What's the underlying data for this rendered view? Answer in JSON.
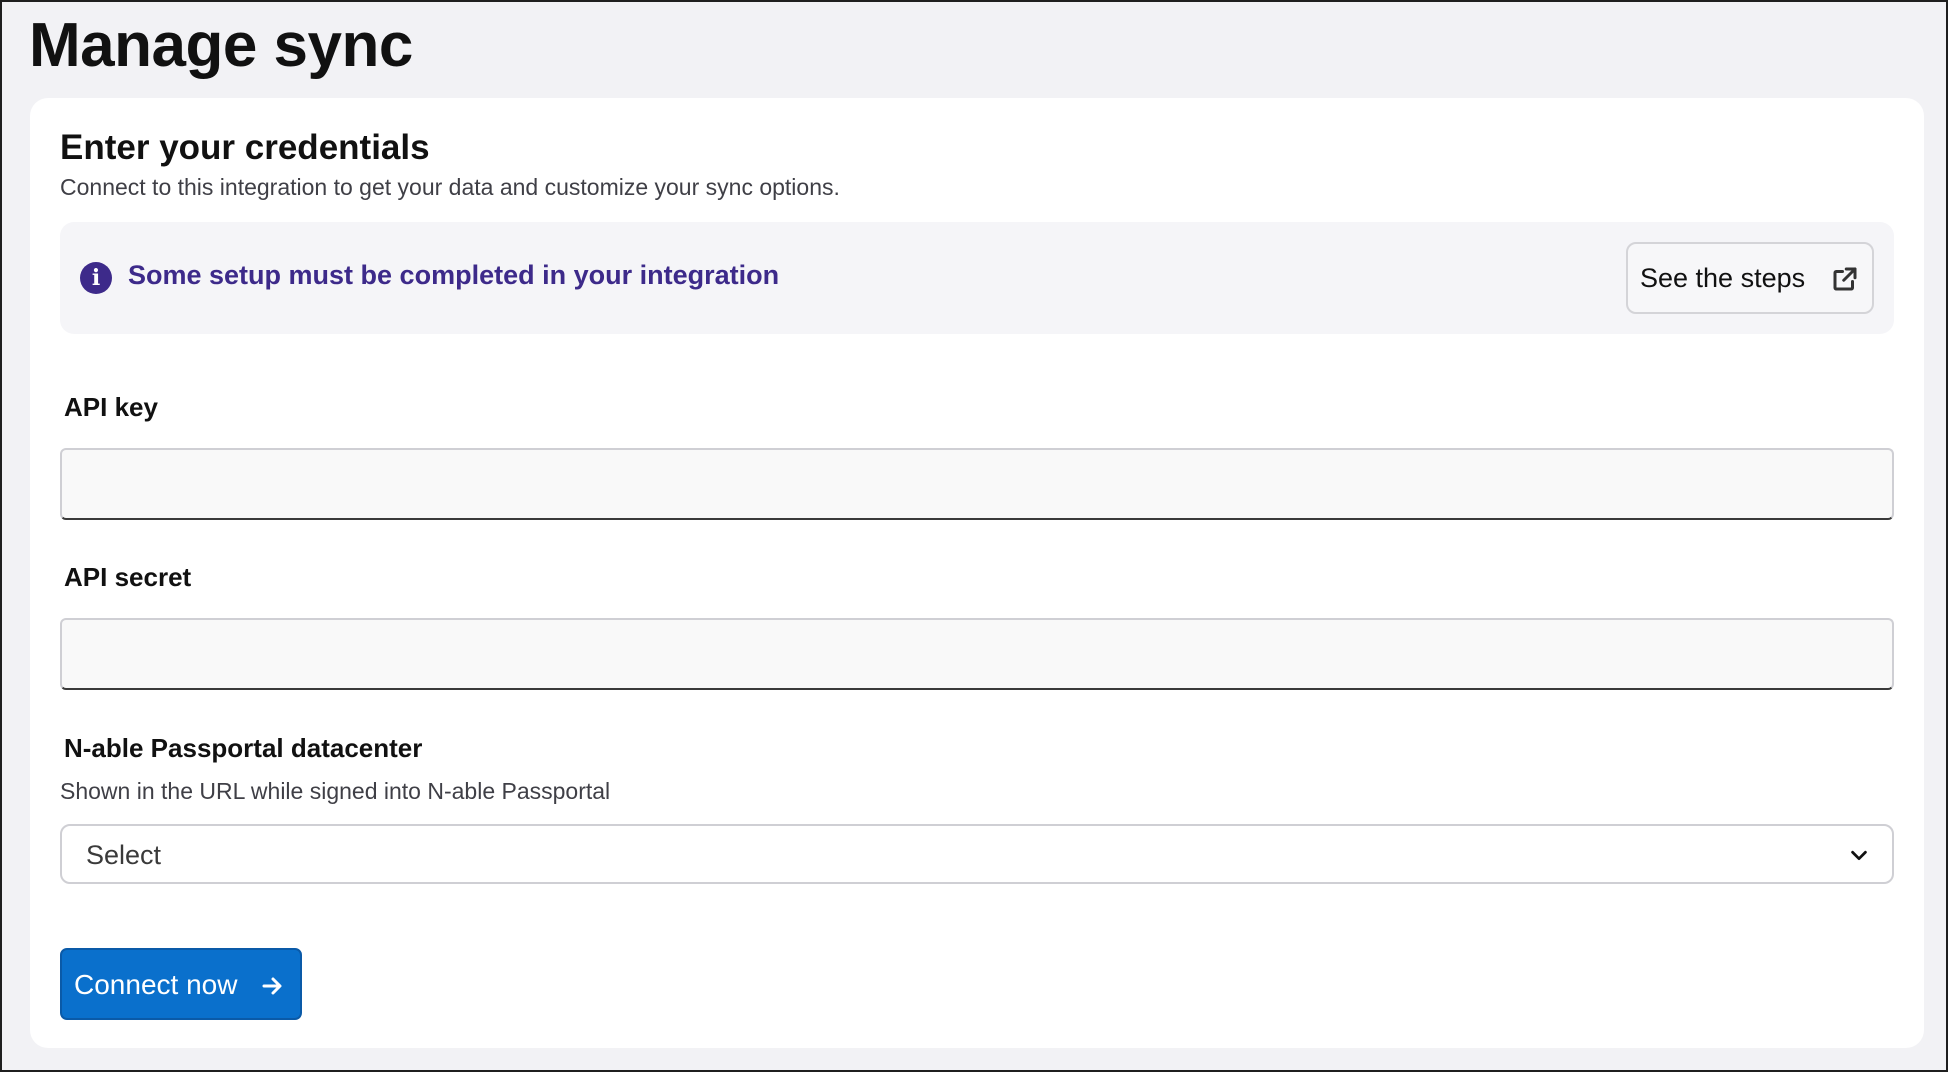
{
  "page": {
    "title": "Manage sync"
  },
  "credentials": {
    "title": "Enter your credentials",
    "subtitle": "Connect to this integration to get your data and customize your sync options."
  },
  "notice": {
    "icon": "info-circle-icon",
    "text": "Some setup must be completed in your integration",
    "button_label": "See the steps",
    "button_icon": "external-link-icon"
  },
  "fields": {
    "api_key": {
      "label": "API key",
      "value": "",
      "placeholder": ""
    },
    "api_secret": {
      "label": "API secret",
      "value": "",
      "placeholder": ""
    },
    "datacenter": {
      "label": "N-able Passportal datacenter",
      "help": "Shown in the URL while signed into N-able Passportal",
      "selected": "Select",
      "icon": "chevron-down-icon"
    }
  },
  "actions": {
    "connect_label": "Connect now",
    "connect_icon": "arrow-right-icon"
  },
  "colors": {
    "background": "#f2f2f5",
    "card": "#ffffff",
    "notice_background": "#f5f5f8",
    "notice_text": "#3d2a8a",
    "primary": "#0a70cc"
  }
}
